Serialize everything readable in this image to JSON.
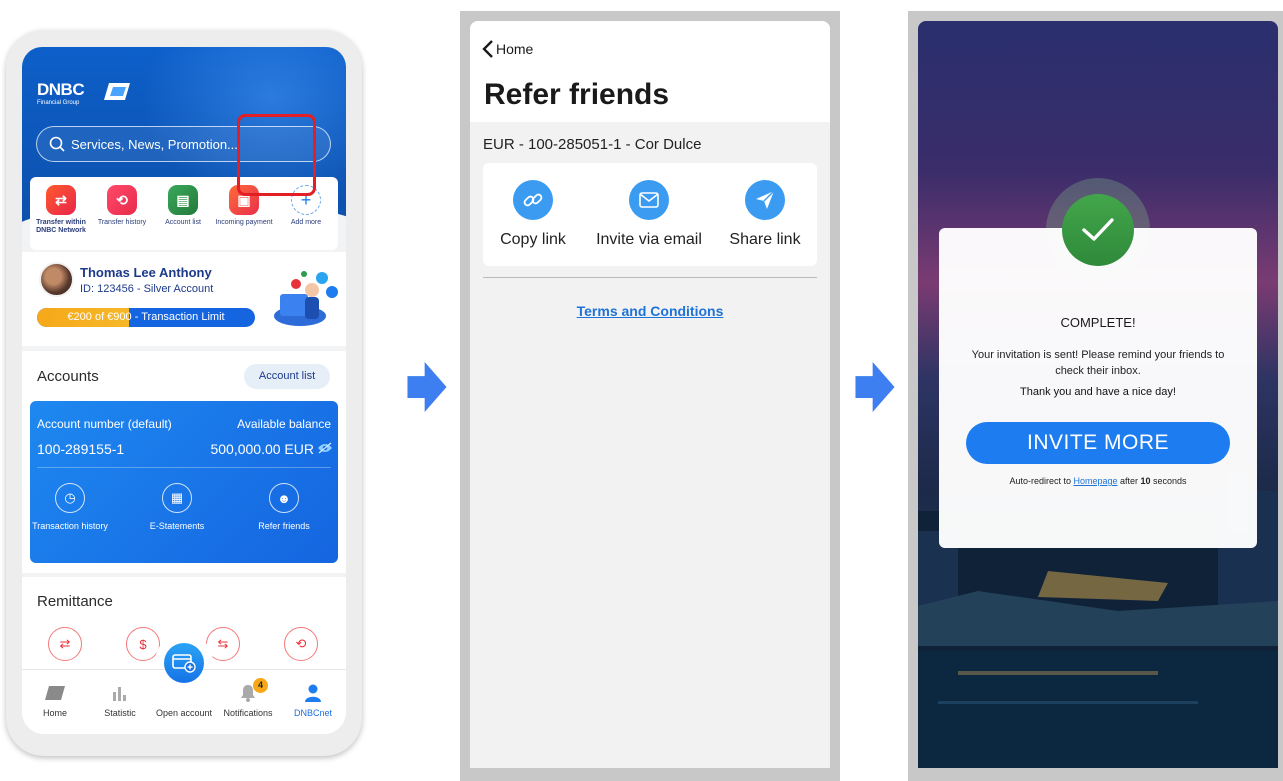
{
  "colors": {
    "brand_blue": "#0d5fc9",
    "accent_orange": "#f6a818",
    "highlight_red": "#e31e24",
    "success_green": "#2f8a3a",
    "link_blue": "#1e73d8"
  },
  "screen1": {
    "logo": {
      "brand": "DNBC",
      "sub": "Financial Group"
    },
    "search": {
      "placeholder": "Services, News, Promotion...",
      "icon": "search-icon"
    },
    "quick_actions": [
      {
        "label": "Transfer within DNBC Network",
        "icon": "transfer-icon",
        "color": "#ef3b3b"
      },
      {
        "label": "Transfer history",
        "icon": "history-icon",
        "color": "#ef3b5a"
      },
      {
        "label": "Account list",
        "icon": "account-list-icon",
        "color": "#2e9a4b"
      },
      {
        "label": "Incoming payment",
        "icon": "incoming-payment-icon",
        "color": "#f0452c"
      },
      {
        "label": "Add more",
        "icon": "plus-icon",
        "color": "#1d7df0"
      }
    ],
    "profile": {
      "name": "Thomas Lee Anthony",
      "id_line": "ID: 123456 - Silver Account",
      "limit_text": "€200 of €900 - Transaction Limit",
      "limit_fraction": 0.222
    },
    "accounts": {
      "title": "Accounts",
      "list_button": "Account list",
      "card": {
        "number_label": "Account number (default)",
        "balance_label": "Available balance",
        "number": "100-289155-1",
        "balance": "500,000.00 EUR",
        "actions": [
          {
            "label": "Transaction history",
            "icon": "transaction-history-icon"
          },
          {
            "label": "E-Statements",
            "icon": "e-statements-icon"
          },
          {
            "label": "Refer friends",
            "icon": "refer-friends-icon"
          }
        ]
      }
    },
    "remittance": {
      "title": "Remittance"
    },
    "tabbar": [
      {
        "label": "Home",
        "icon": "home-icon"
      },
      {
        "label": "Statistic",
        "icon": "statistic-icon"
      },
      {
        "label": "Open account",
        "icon": "open-account-icon"
      },
      {
        "label": "Notifications",
        "icon": "bell-icon"
      },
      {
        "label": "DNBCnet",
        "icon": "user-icon"
      }
    ],
    "notification_count": "4"
  },
  "screen2": {
    "back_label": "Home",
    "title": "Refer friends",
    "account": "EUR - 100-285051-1 - Cor Dulce",
    "share_options": [
      {
        "label": "Copy link",
        "icon": "link-icon"
      },
      {
        "label": "Invite via email",
        "icon": "email-icon"
      },
      {
        "label": "Share link",
        "icon": "paper-plane-icon"
      }
    ],
    "terms": "Terms and Conditions"
  },
  "screen3": {
    "title": "COMPLETE!",
    "message": "Your invitation is sent! Please remind your friends to check their inbox.",
    "thanks": "Thank you and have a nice day!",
    "button": "INVITE MORE",
    "auto_prefix": "Auto-redirect to ",
    "auto_link": "Homepage",
    "auto_mid": " after ",
    "auto_seconds": "10",
    "auto_suffix": " seconds"
  }
}
